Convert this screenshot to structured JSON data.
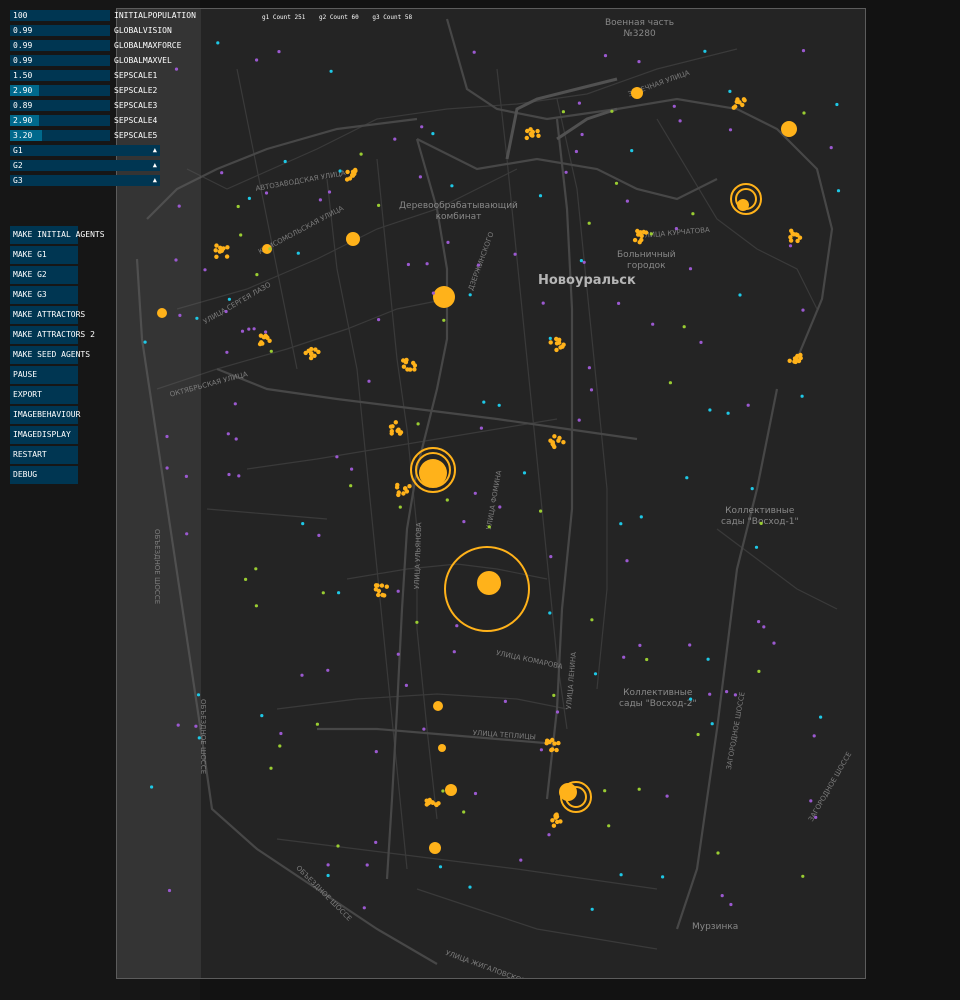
{
  "sliders": [
    {
      "value": "100",
      "name": "INITIALPOPULATION",
      "fill": 0.0
    },
    {
      "value": "0.99",
      "name": "GLOBALVISION",
      "fill": 0.0
    },
    {
      "value": "0.99",
      "name": "GLOBALMAXFORCE",
      "fill": 0.0
    },
    {
      "value": "0.99",
      "name": "GLOBALMAXVEL",
      "fill": 0.0
    },
    {
      "value": "1.50",
      "name": "SEPSCALE1",
      "fill": 0.0
    },
    {
      "value": "2.90",
      "name": "SEPSCALE2",
      "fill": 0.29
    },
    {
      "value": "0.89",
      "name": "SEPSCALE3",
      "fill": 0.0
    },
    {
      "value": "2.90",
      "name": "SEPSCALE4",
      "fill": 0.29
    },
    {
      "value": "3.20",
      "name": "SEPSCALE5",
      "fill": 0.32
    }
  ],
  "dropdowns": [
    "G1",
    "G2",
    "G3"
  ],
  "buttons": [
    "MAKE INITIAL AGENTS",
    "MAKE G1",
    "MAKE G2",
    "MAKE G3",
    "MAKE ATTRACTORS",
    "MAKE ATTRACTORS 2",
    "MAKE SEED AGENTS",
    "PAUSE",
    "EXPORT",
    "IMAGEBEHAVIOUR",
    "IMAGEDISPLAY",
    "RESTART",
    "DEBUG"
  ],
  "counts": {
    "g1": "g1 Count 251",
    "g2": "g2 Count 60",
    "g3": "g3 Count 58"
  },
  "map": {
    "city": "Новоуральск",
    "military": "Военная часть\n№3280",
    "combinat": "Деревообрабатывающий\nкомбинат",
    "hospital": "Больничный\nгородок",
    "gardens1": "Коллективные\nсады \"Восход-1\"",
    "gardens2": "Коллективные\nсады \"Восход-2\"",
    "murzinka": "Мурзинка",
    "streets": {
      "avtozavodskaya": "АВТОЗАВОДСКАЯ УЛИЦА",
      "komsomolskaya": "КОМСОМОЛЬСКАЯ УЛИЦА",
      "oktyabrskaya": "ОКТЯБРЬСКАЯ УЛИЦА",
      "fomina": "УЛИЦА ФОМИНА",
      "teplicy": "УЛИЦА ТЕПЛИЦЫ",
      "komarova": "УЛИЦА КОМАРОВА",
      "zhigalovskogo": "УЛИЦА ЖИГАЛОВСКОГО",
      "obezdnoe": "ОБЪЕЗДНОЕ ШОССЕ",
      "zagorodnoe": "ЗАГОРОДНОЕ ШОССЕ",
      "zarechnaya": "ЗАРЕЧНАЯ УЛИЦА",
      "dzerzhinskogo": "ДЗЕРЖИНСКОГО",
      "sergeya_lazo": "УЛИЦА СЕРГЕЯ ЛАЗО",
      "kurchatova": "УЛИЦА КУРЧАТОВА",
      "lenina": "УЛИЦА ЛЕНИНА",
      "ulyanovskaya": "УЛИЦА УЛЬЯНОВА"
    }
  },
  "colors": {
    "accent": "#ffb21a",
    "g2": "#9b59d0",
    "g3": "#9acd32",
    "g1": "#1ec8e6",
    "panel": "#003652",
    "fill": "#00698c"
  }
}
